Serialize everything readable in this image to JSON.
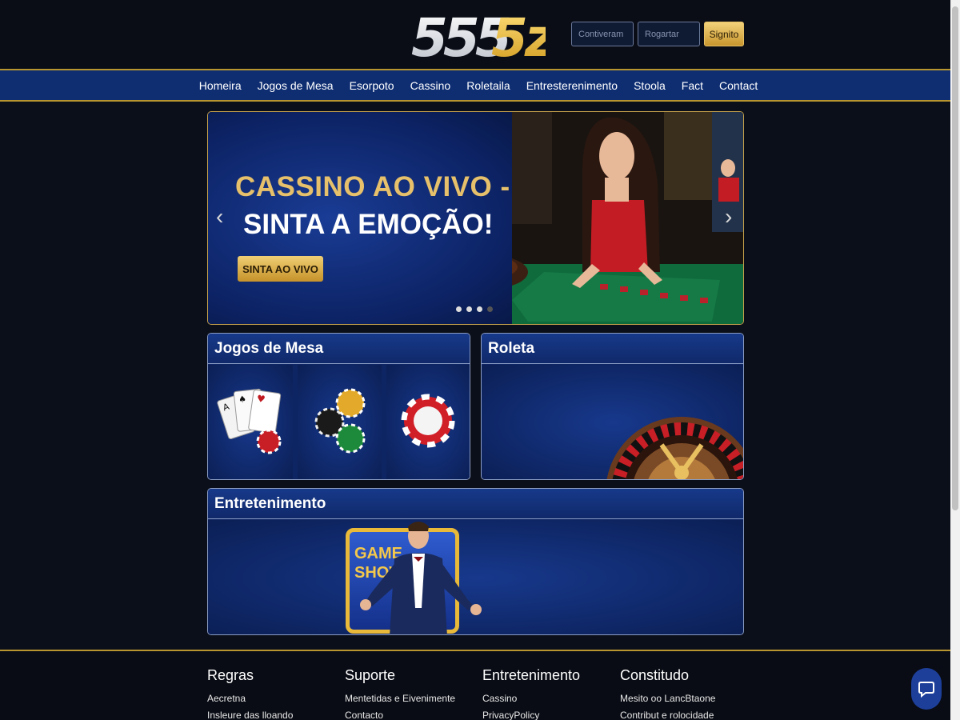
{
  "brand": {
    "logo_text": "5555z",
    "accent": "#d4a93a",
    "nav_blue": "#0f2e72"
  },
  "header": {
    "username_placeholder": "Contiveram",
    "password_placeholder": "Rogartar",
    "signin_label": "Signito"
  },
  "nav": {
    "items": [
      {
        "label": "Homeira"
      },
      {
        "label": "Jogos de Mesa"
      },
      {
        "label": "Esorpoto"
      },
      {
        "label": "Cassino"
      },
      {
        "label": "Roletaila"
      },
      {
        "label": "Entresterenimento"
      },
      {
        "label": "Stoola"
      },
      {
        "label": "Fact"
      },
      {
        "label": "Contact"
      }
    ]
  },
  "hero": {
    "title_line1": "CASSINO AO VIVO -",
    "title_line2": "SINTA A EMOÇÃO!",
    "cta_label": "SINTA AO VIVO",
    "prev_icon": "chevron-left-icon",
    "next_icon": "chevron-right-icon",
    "slides": 4,
    "active_slide": 3
  },
  "sections": {
    "table_games": {
      "title": "Jogos de Mesa"
    },
    "roulette": {
      "title": "Roleta"
    },
    "entertainment": {
      "title": "Entretenimento",
      "badge_line1": "GAME",
      "badge_line2": "SHOW"
    }
  },
  "footer": {
    "columns": [
      {
        "title": "Regras",
        "links": [
          "Aecretna",
          "Insleure das lloando"
        ]
      },
      {
        "title": "Suporte",
        "links": [
          "Mentetidas e Eivenimente",
          "Contacto"
        ]
      },
      {
        "title": "Entretenimento",
        "links": [
          "Cassino",
          "PrivacyPolicy"
        ]
      },
      {
        "title": "Constitudo",
        "links": [
          "Mesito oo LancBtaone",
          "Contribut e rolocidade"
        ]
      }
    ]
  },
  "chat": {
    "icon": "chat-bubble-icon"
  }
}
